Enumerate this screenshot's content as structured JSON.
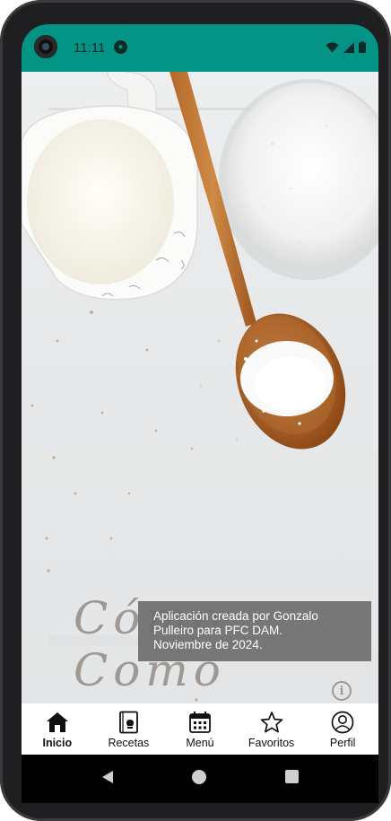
{
  "status_bar": {
    "time": "11:11",
    "app_notification_icon": "app-icon",
    "background_color": "#039485"
  },
  "hero": {
    "description": "background photo: milk pitcher, wooden spoon with coconut flakes, glass bowl",
    "watermark_text": "Cómo Como"
  },
  "toast": {
    "line1": "Aplicación creada por Gonzalo",
    "line2": "Pulleiro para PFC DAM.",
    "line3": "Noviembre de 2024."
  },
  "bottom_nav": {
    "items": [
      {
        "label": "Inicio",
        "icon": "home-icon",
        "active": true
      },
      {
        "label": "Recetas",
        "icon": "recipe-book-icon",
        "active": false
      },
      {
        "label": "Menú",
        "icon": "calendar-icon",
        "active": false
      },
      {
        "label": "Favoritos",
        "icon": "star-icon",
        "active": false
      },
      {
        "label": "Perfil",
        "icon": "profile-icon",
        "active": false
      }
    ]
  }
}
